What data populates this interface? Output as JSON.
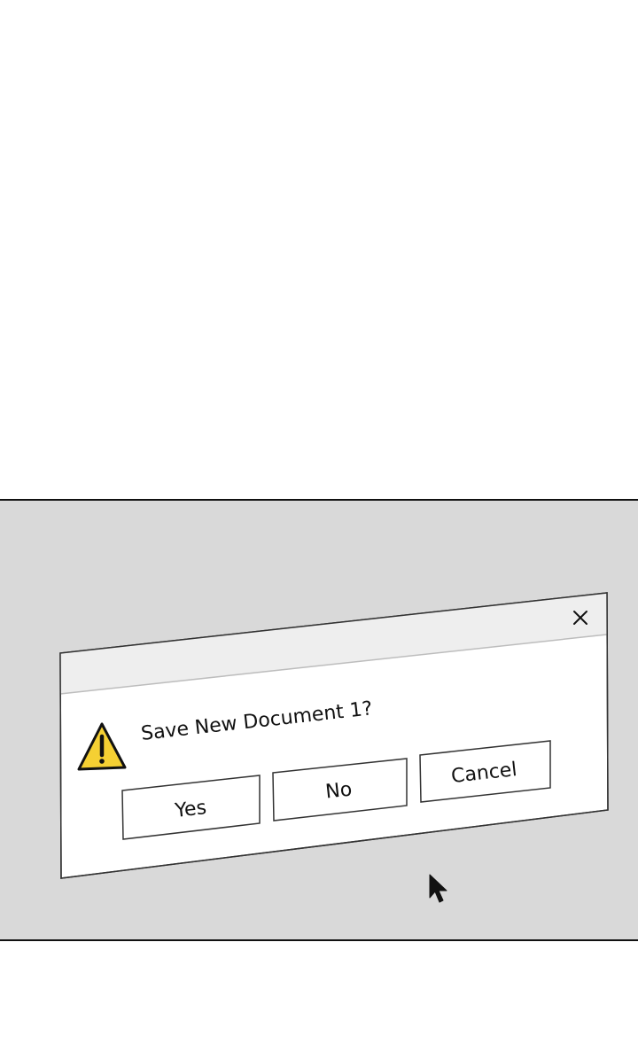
{
  "dialog": {
    "message": "Save New Document 1?",
    "close_glyph": "✕",
    "buttons": {
      "yes": "Yes",
      "no": "No",
      "cancel": "Cancel"
    },
    "icons": {
      "warning": "warning-triangle-icon",
      "close": "close-icon",
      "cursor": "mouse-pointer-icon"
    }
  },
  "colors": {
    "backdrop": "#d9d9d9",
    "title_bar": "#eeeeee",
    "dialog_body": "#ffffff",
    "warning_yellow": "#f5d033",
    "outline": "#111111"
  }
}
